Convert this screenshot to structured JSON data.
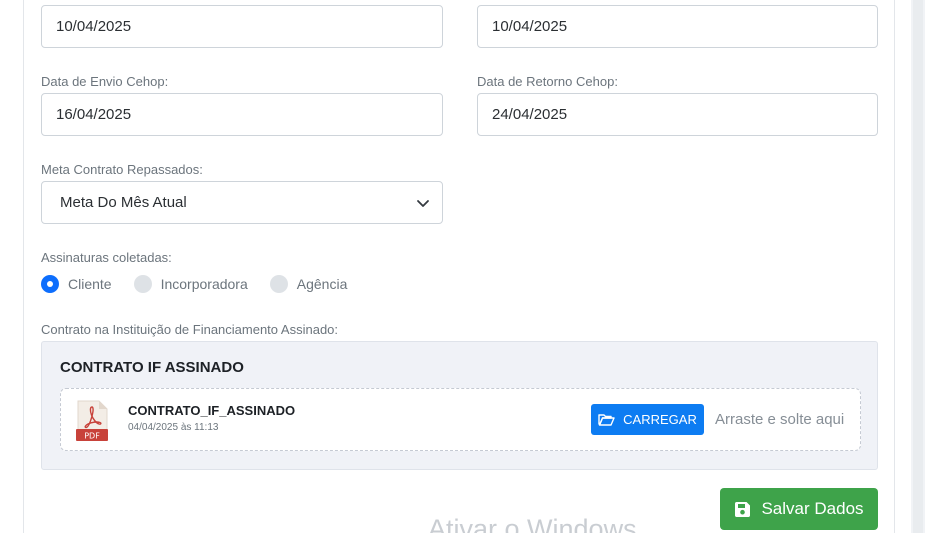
{
  "fields": {
    "date_left_top": {
      "value": "10/04/2025"
    },
    "date_right_top": {
      "value": "10/04/2025"
    },
    "envio_cehop": {
      "label": "Data de Envio Cehop:",
      "value": "16/04/2025"
    },
    "retorno_cehop": {
      "label": "Data de Retorno Cehop:",
      "value": "24/04/2025"
    },
    "meta_contrato": {
      "label": "Meta Contrato Repassados:",
      "value": "Meta Do Mês Atual"
    }
  },
  "assinaturas": {
    "label": "Assinaturas coletadas:",
    "options": [
      {
        "label": "Cliente",
        "checked": true
      },
      {
        "label": "Incorporadora",
        "checked": false
      },
      {
        "label": "Agência",
        "checked": false
      }
    ]
  },
  "contrato_if": {
    "label": "Contrato na Instituição de Financiamento Assinado:",
    "panel_title": "CONTRATO IF ASSINADO",
    "file": {
      "icon": "pdf-file-icon",
      "icon_text": "PDF",
      "name": "CONTRATO_IF_ASSINADO",
      "date": "04/04/2025 às 11:13"
    },
    "upload_button": "CARREGAR",
    "drop_hint": "Arraste e solte aqui"
  },
  "save_button": {
    "label": "Salvar Dados",
    "icon": "save-icon"
  },
  "watermark": "Ativar o Windows",
  "colors": {
    "primary": "#0d7cf2",
    "success": "#3ea34a",
    "pdf_red": "#c8423a",
    "radio_checked": "#0d6efd"
  }
}
